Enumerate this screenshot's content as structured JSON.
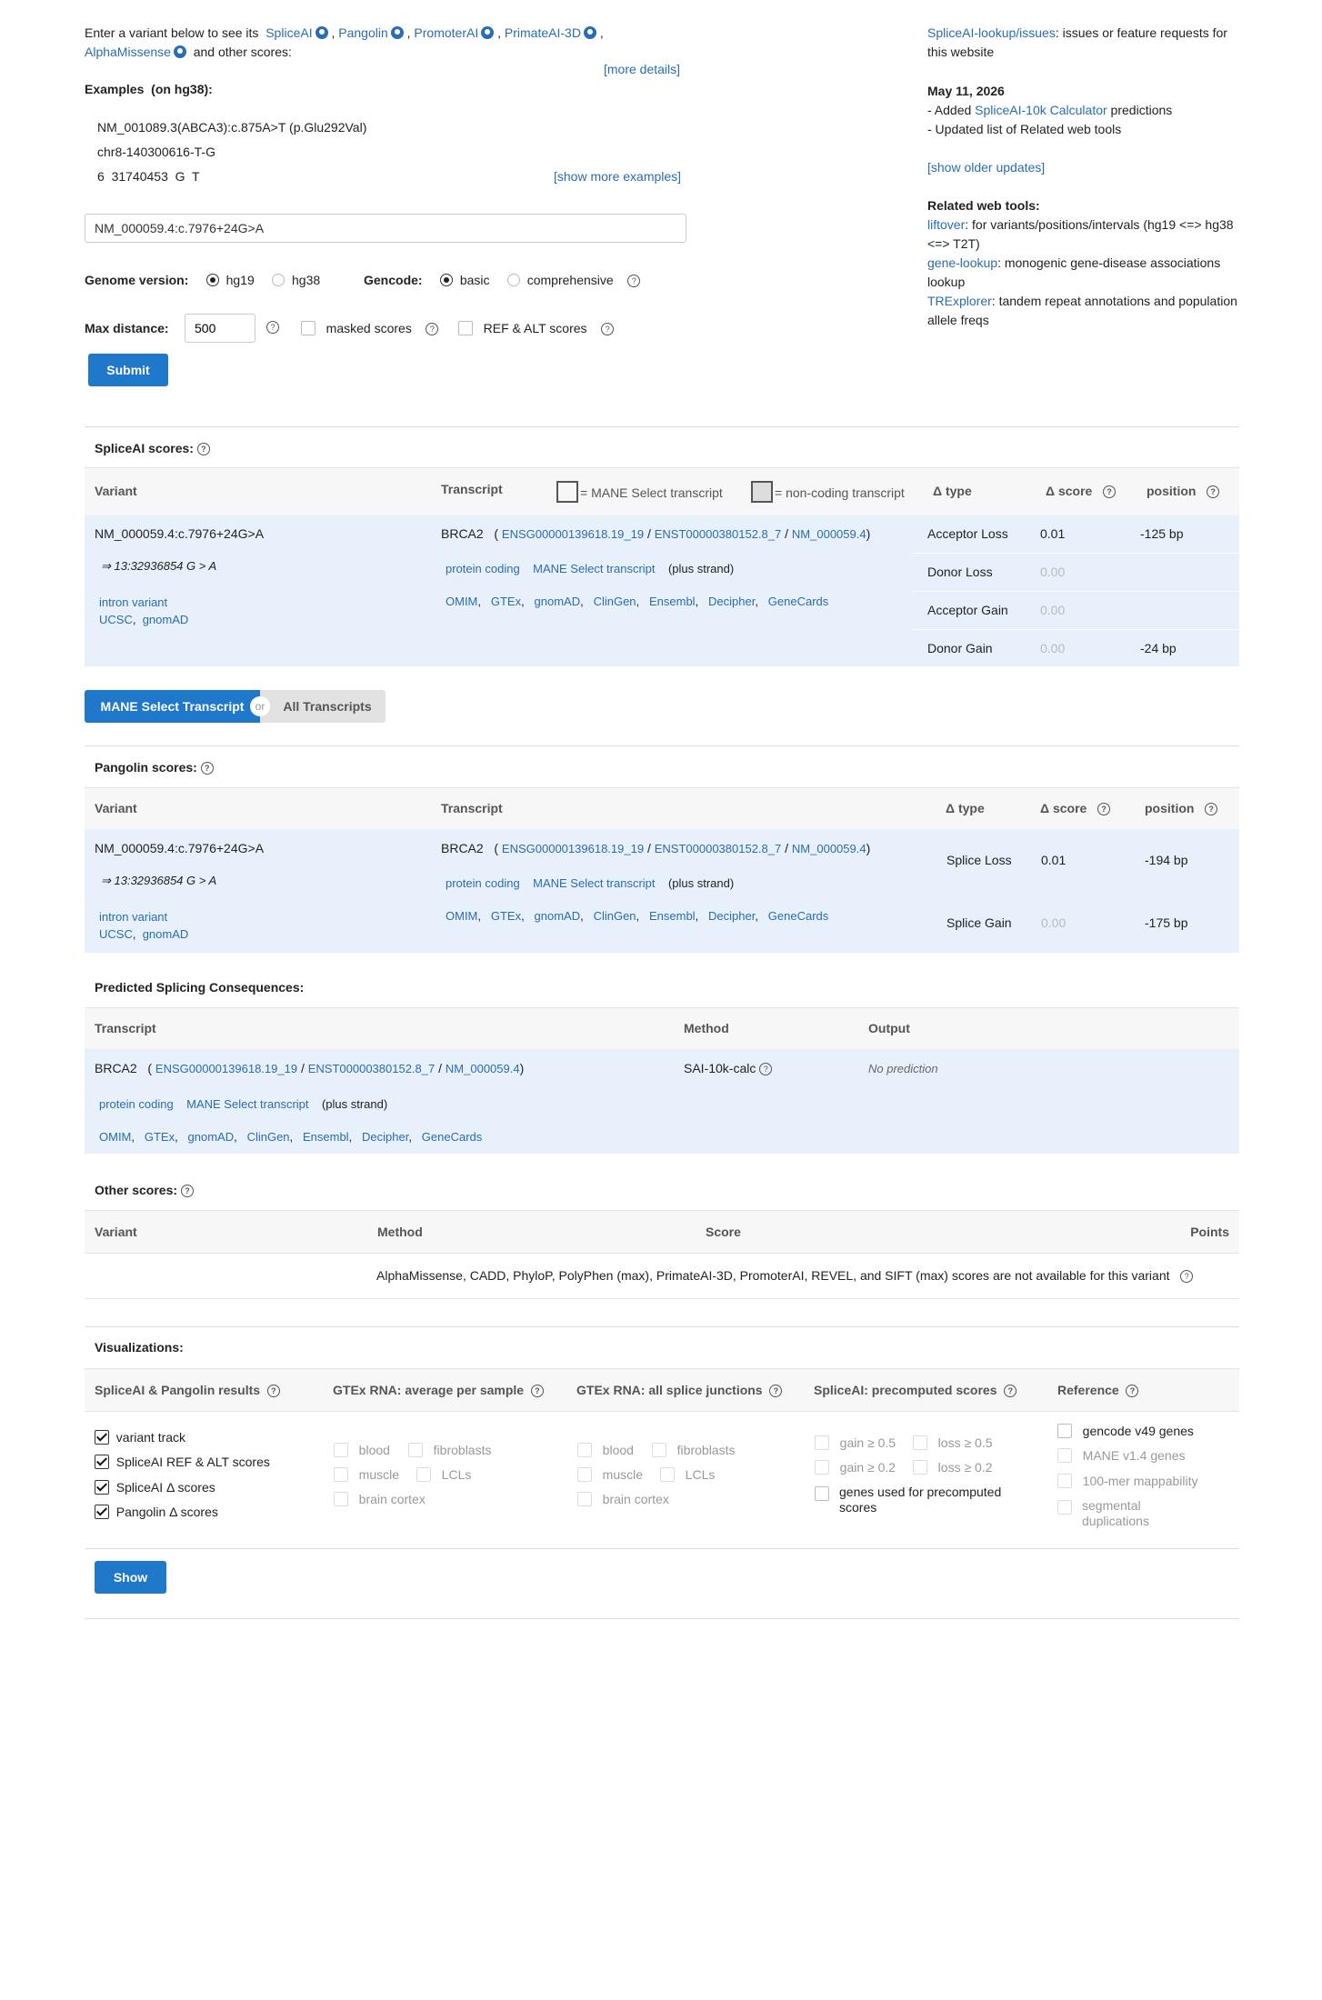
{
  "intro": {
    "text1": "Enter a variant below to see its",
    "tools": [
      "SpliceAI",
      "Pangolin",
      "PromoterAI",
      "PrimateAI-3D",
      "AlphaMissense"
    ],
    "text2": "and other scores:",
    "more_details": "[more details]"
  },
  "examples": {
    "title": "Examples",
    "genome": "(on hg38):",
    "items": [
      "NM_001089.3(ABCA3):c.875A>T (p.Glu292Val)",
      "chr8-140300616-T-G",
      "6  31740453  G  T"
    ],
    "show_more": "[show more examples]"
  },
  "search": {
    "value": "NM_000059.4:c.7976+24G>A"
  },
  "options": {
    "genome_label": "Genome version:",
    "genome_opts": [
      "hg19",
      "hg38"
    ],
    "gencode_label": "Gencode:",
    "gencode_opts": [
      "basic",
      "comprehensive"
    ],
    "maxdist_label": "Max distance:",
    "maxdist_value": "500",
    "masked": "masked scores",
    "refalt": "REF & ALT scores",
    "submit": "Submit"
  },
  "sidebar": {
    "issues_link": "SpliceAI-lookup/issues",
    "issues_text": ": issues or feature requests for this website",
    "date": "May 11, 2026",
    "update1_pre": "- Added ",
    "update1_link": "SpliceAI-10k Calculator",
    "update1_post": " predictions",
    "update2": "- Updated list of Related web tools",
    "older": "[show older updates]",
    "related_title": "Related web tools:",
    "tools": [
      {
        "name": "liftover",
        "desc": ": for variants/positions/intervals (hg19 <=> hg38 <=> T2T)"
      },
      {
        "name": "gene-lookup",
        "desc": ": monogenic gene-disease associations lookup"
      },
      {
        "name": "TRExplorer",
        "desc": ": tandem repeat annotations and population allele freqs"
      }
    ]
  },
  "spliceai": {
    "title": "SpliceAI scores:",
    "headers": {
      "variant": "Variant",
      "transcript": "Transcript",
      "mane_legend": "= MANE Select transcript",
      "nc_legend": "= non-coding transcript",
      "dtype": "Δ type",
      "dscore": "Δ score",
      "position": "position"
    },
    "variant": "NM_000059.4:c.7976+24G>A",
    "coord": "⇒ 13:32936854 G > A",
    "consequence": "intron variant",
    "ucsc": "UCSC",
    "gnomad": "gnomAD",
    "gene": "BRCA2",
    "ensg": "ENSG00000139618.19_19",
    "enst": "ENST00000380152.8_7",
    "nm": "NM_000059.4",
    "biotype": "protein coding",
    "mane": "MANE Select transcript",
    "strand": "(plus strand)",
    "links": [
      "OMIM",
      "GTEx",
      "gnomAD",
      "ClinGen",
      "Ensembl",
      "Decipher",
      "GeneCards"
    ],
    "rows": [
      {
        "type": "Acceptor Loss",
        "score": "0.01",
        "pos": "-125 bp"
      },
      {
        "type": "Donor Loss",
        "score": "0.00",
        "pos": ""
      },
      {
        "type": "Acceptor Gain",
        "score": "0.00",
        "pos": ""
      },
      {
        "type": "Donor Gain",
        "score": "0.00",
        "pos": "-24 bp"
      }
    ]
  },
  "toggle": {
    "left": "MANE Select Transcript",
    "or": "or",
    "right": "All Transcripts"
  },
  "pangolin": {
    "title": "Pangolin scores:",
    "rows": [
      {
        "type": "Splice Loss",
        "score": "0.01",
        "pos": "-194 bp"
      },
      {
        "type": "Splice Gain",
        "score": "0.00",
        "pos": "-175 bp"
      }
    ]
  },
  "consequences": {
    "title": "Predicted Splicing Consequences:",
    "h_transcript": "Transcript",
    "h_method": "Method",
    "h_output": "Output",
    "method": "SAI-10k-calc",
    "output": "No prediction"
  },
  "other": {
    "title": "Other scores:",
    "h_variant": "Variant",
    "h_method": "Method",
    "h_score": "Score",
    "h_points": "Points",
    "message": "AlphaMissense,  CADD,  PhyloP,  PolyPhen (max),  PrimateAI-3D,  PromoterAI,  REVEL,  and SIFT (max) scores are not available for this variant"
  },
  "viz": {
    "title": "Visualizations:",
    "col1": "SpliceAI & Pangolin results",
    "col2": "GTEx RNA: average per sample",
    "col3": "GTEx RNA: all splice junctions",
    "col4": "SpliceAI: precomputed scores",
    "col5": "Reference",
    "c1": [
      "variant track",
      "SpliceAI REF & ALT scores",
      "SpliceAI Δ  scores",
      "Pangolin Δ  scores"
    ],
    "tissues": [
      "blood",
      "fibroblasts",
      "muscle",
      "LCLs",
      "brain cortex"
    ],
    "pre": [
      "gain ≥ 0.5",
      "loss ≥ 0.5",
      "gain ≥ 0.2",
      "loss ≥ 0.2",
      "genes used for precomputed scores"
    ],
    "ref": [
      "gencode v49 genes",
      "MANE v1.4 genes",
      "100-mer mappability",
      "segmental duplications"
    ],
    "show": "Show"
  }
}
